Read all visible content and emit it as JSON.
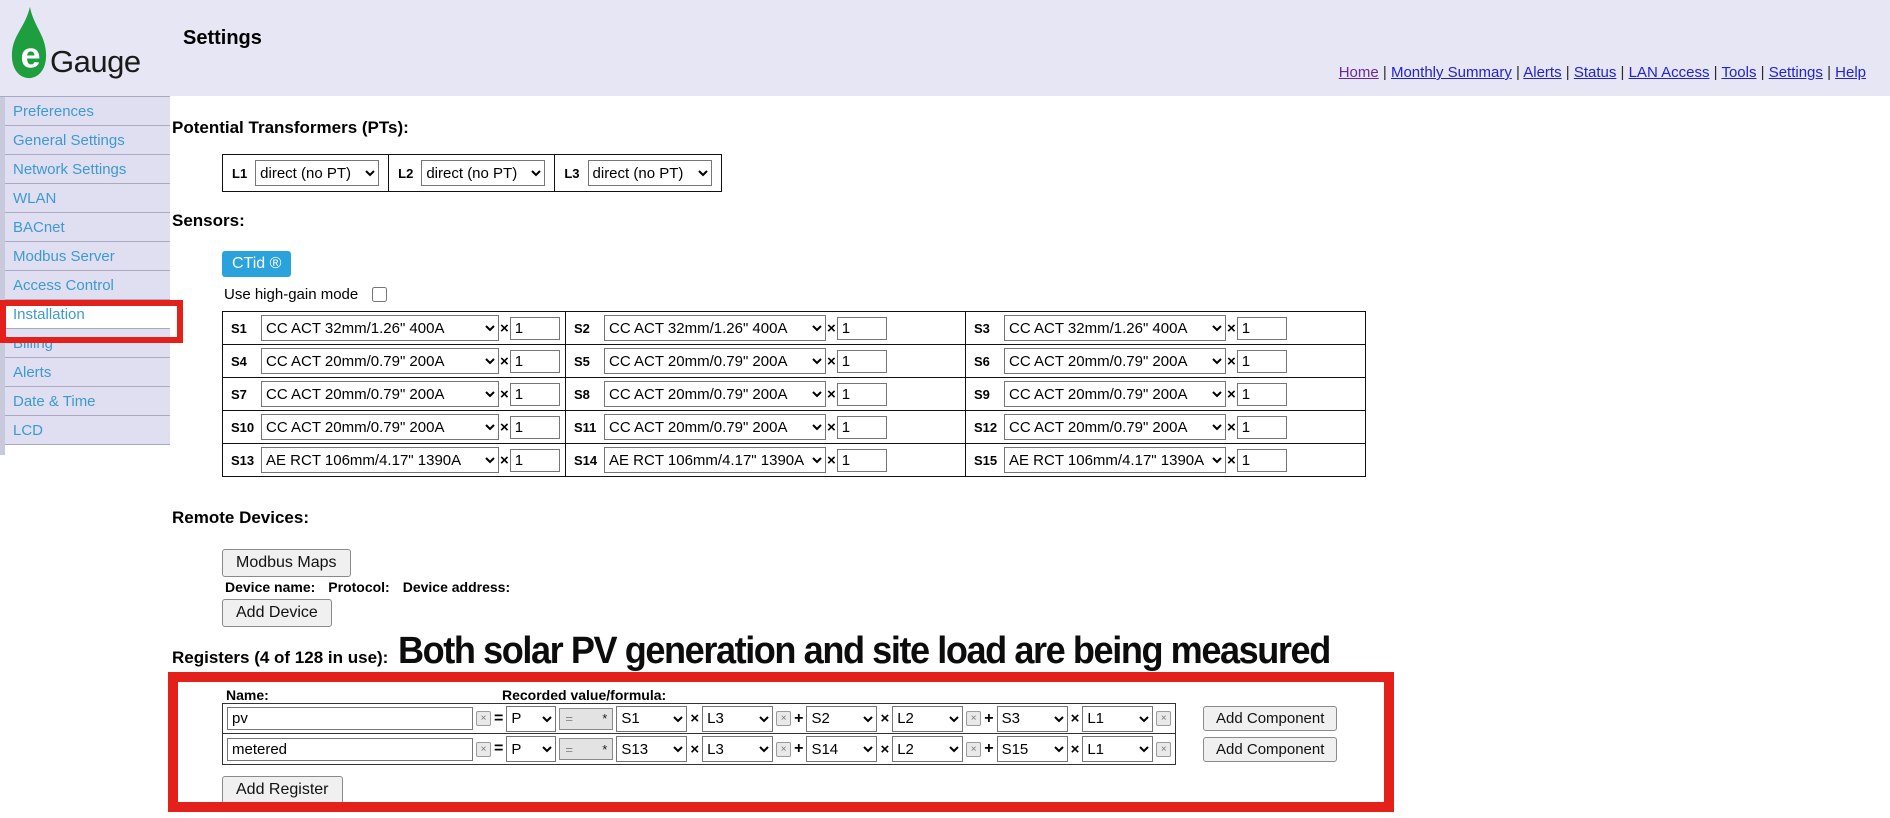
{
  "brand": {
    "logo_letter": "e",
    "name": "Gauge"
  },
  "page_title": "Settings",
  "nav": {
    "separator": "|",
    "items": [
      "Home",
      "Monthly Summary",
      "Alerts",
      "Status",
      "LAN Access",
      "Tools",
      "Settings",
      "Help"
    ],
    "visited": "Home"
  },
  "sidebar": {
    "items": [
      "Preferences",
      "General Settings",
      "Network Settings",
      "WLAN",
      "BACnet",
      "Modbus Server",
      "Access Control",
      "Installation",
      "Billing",
      "Alerts",
      "Date & Time",
      "LCD"
    ],
    "active": "Installation"
  },
  "pt_section": {
    "heading": "Potential Transformers (PTs):",
    "phases": [
      {
        "label": "L1",
        "value": "direct (no PT)"
      },
      {
        "label": "L2",
        "value": "direct (no PT)"
      },
      {
        "label": "L3",
        "value": "direct (no PT)"
      }
    ]
  },
  "sensors_section": {
    "heading": "Sensors:",
    "ctid_button": "CTid ®",
    "high_gain_label": "Use high-gain mode",
    "rows": [
      [
        {
          "label": "S1",
          "type": "CC ACT 32mm/1.26\" 400A",
          "scale": "1"
        },
        {
          "label": "S2",
          "type": "CC ACT 32mm/1.26\" 400A",
          "scale": "1"
        },
        {
          "label": "S3",
          "type": "CC ACT 32mm/1.26\" 400A",
          "scale": "1"
        }
      ],
      [
        {
          "label": "S4",
          "type": "CC ACT 20mm/0.79\" 200A",
          "scale": "1"
        },
        {
          "label": "S5",
          "type": "CC ACT 20mm/0.79\" 200A",
          "scale": "1"
        },
        {
          "label": "S6",
          "type": "CC ACT 20mm/0.79\" 200A",
          "scale": "1"
        }
      ],
      [
        {
          "label": "S7",
          "type": "CC ACT 20mm/0.79\" 200A",
          "scale": "1"
        },
        {
          "label": "S8",
          "type": "CC ACT 20mm/0.79\" 200A",
          "scale": "1"
        },
        {
          "label": "S9",
          "type": "CC ACT 20mm/0.79\" 200A",
          "scale": "1"
        }
      ],
      [
        {
          "label": "S10",
          "type": "CC ACT 20mm/0.79\" 200A",
          "scale": "1"
        },
        {
          "label": "S11",
          "type": "CC ACT 20mm/0.79\" 200A",
          "scale": "1"
        },
        {
          "label": "S12",
          "type": "CC ACT 20mm/0.79\" 200A",
          "scale": "1"
        }
      ],
      [
        {
          "label": "S13",
          "type": "AE RCT 106mm/4.17\" 1390A",
          "scale": "1"
        },
        {
          "label": "S14",
          "type": "AE RCT 106mm/4.17\" 1390A",
          "scale": "1"
        },
        {
          "label": "S15",
          "type": "AE RCT 106mm/4.17\" 1390A",
          "scale": "1"
        }
      ]
    ]
  },
  "remote_devices": {
    "heading": "Remote Devices:",
    "modbus_maps_button": "Modbus Maps",
    "device_name_label": "Device name:",
    "protocol_label": "Protocol:",
    "device_address_label": "Device address:",
    "add_device_button": "Add Device"
  },
  "registers": {
    "heading": "Registers (4 of 128 in use):",
    "annotation": "Both solar PV generation and site load are being measured",
    "name_header": "Name:",
    "formula_header": "Recorded value/formula:",
    "add_component_button": "Add Component",
    "add_register_button": "Add Register",
    "operators": {
      "equals": "=",
      "times": "×",
      "plus": "+",
      "remove": "×"
    },
    "rows": [
      {
        "name": "pv",
        "type": "P",
        "subtype": "=",
        "subtype_hint": "*",
        "components": [
          {
            "sensor": "S1",
            "line": "L3"
          },
          {
            "sensor": "S2",
            "line": "L2"
          },
          {
            "sensor": "S3",
            "line": "L1"
          }
        ]
      },
      {
        "name": "metered",
        "type": "P",
        "subtype": "=",
        "subtype_hint": "*",
        "components": [
          {
            "sensor": "S13",
            "line": "L3"
          },
          {
            "sensor": "S14",
            "line": "L2"
          },
          {
            "sensor": "S15",
            "line": "L1"
          }
        ]
      }
    ]
  },
  "colors": {
    "header_bg": "#e6e6f5",
    "sidebar_bg": "#dfdff1",
    "sidebar_link": "#3d9ad1",
    "link_blue": "#2323cf",
    "link_visited": "#6a2a9d",
    "ctid_bg": "#2aa2dc",
    "annotation_red": "#e32019",
    "button_bg": "#f0f0f0"
  }
}
